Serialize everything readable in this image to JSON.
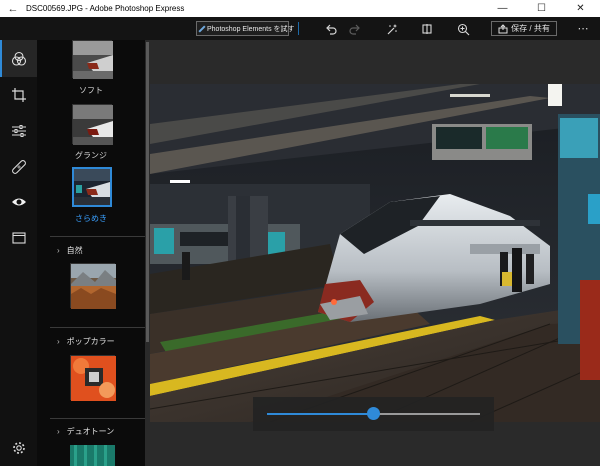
{
  "window": {
    "title": "DSC00569.JPG - Adobe Photoshop Express",
    "back_glyph": "←",
    "minimize_glyph": "—",
    "maximize_glyph": "☐",
    "close_glyph": "✕"
  },
  "toolbar": {
    "promo_label": "Photoshop Elements を試す",
    "save_label": "保存 / 共有",
    "more_glyph": "⋯",
    "icons": [
      "undo-icon",
      "redo-icon",
      "auto-fix-icon",
      "compare-icon",
      "zoom-in-icon",
      "share-icon"
    ]
  },
  "rail": {
    "items": [
      "looks-icon",
      "crop-icon",
      "adjustments-icon",
      "healing-icon",
      "red-eye-icon",
      "borders-icon",
      "settings-icon"
    ],
    "active": "looks-icon"
  },
  "panel": {
    "looks": [
      {
        "label": "ソフト",
        "selected": false
      },
      {
        "label": "グランジ",
        "selected": false
      },
      {
        "label": "さらめき",
        "selected": true
      }
    ],
    "categories": [
      {
        "label": "自然"
      },
      {
        "label": "ポップカラー"
      },
      {
        "label": "デュオトーン"
      }
    ]
  },
  "slider": {
    "value": 0.5
  },
  "colors": {
    "accent": "#2f8ad8",
    "toolbar_bg": "#141414",
    "panel_bg": "#0b0b0b",
    "canvas_bg": "#2a2a2a"
  }
}
